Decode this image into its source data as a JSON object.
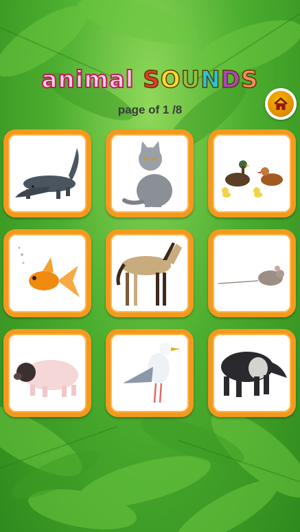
{
  "app": {
    "title_word1": "animal",
    "title_word2_letters": [
      "S",
      "O",
      "U",
      "N",
      "D",
      "S"
    ],
    "title_word2_colors": [
      "#e53935",
      "#fdd835",
      "#8bc34a",
      "#26c6da",
      "#ab47bc",
      "#ff8a65"
    ],
    "page_label": "page of  1 /8"
  },
  "home_button": {
    "icon": "home-icon"
  },
  "animals": [
    {
      "name": "alligator"
    },
    {
      "name": "cat"
    },
    {
      "name": "ducks"
    },
    {
      "name": "goldfish"
    },
    {
      "name": "horse"
    },
    {
      "name": "mouse"
    },
    {
      "name": "pig"
    },
    {
      "name": "seagull"
    },
    {
      "name": "tapir"
    }
  ],
  "colors": {
    "card_border": "#f39a1e",
    "background": "#4cae2f"
  }
}
